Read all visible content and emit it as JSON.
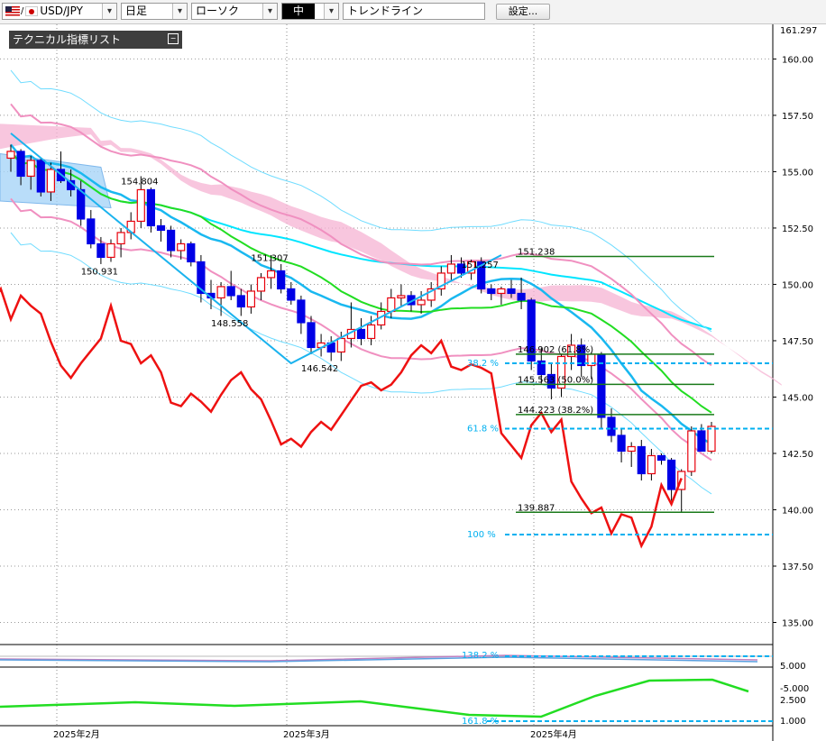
{
  "toolbar": {
    "symbol": "USD/JPY",
    "timeframe": "日足",
    "chart_type": "ローソク",
    "line_width": "中",
    "tool": "トレンドライン",
    "settings_label": "設定..."
  },
  "legend": {
    "label": "テクニカル指標リスト"
  },
  "axis": {
    "top_label": "161.297",
    "price_ticks": [
      {
        "v": 160.0,
        "t": "160.00"
      },
      {
        "v": 157.5,
        "t": "157.50"
      },
      {
        "v": 155.0,
        "t": "155.00"
      },
      {
        "v": 152.5,
        "t": "152.50"
      },
      {
        "v": 150.0,
        "t": "150.00"
      },
      {
        "v": 147.5,
        "t": "147.50"
      },
      {
        "v": 145.0,
        "t": "145.00"
      },
      {
        "v": 142.5,
        "t": "142.50"
      },
      {
        "v": 140.0,
        "t": "140.00"
      },
      {
        "v": 137.5,
        "t": "137.50"
      },
      {
        "v": 135.0,
        "t": "135.00"
      }
    ],
    "sub1_ticks": [
      {
        "t": "5.000"
      },
      {
        "t": "-5.000"
      }
    ],
    "sub2_ticks": [
      {
        "t": "2.500"
      },
      {
        "t": "1.000"
      }
    ],
    "dates": [
      "2025年2月",
      "2025年3月",
      "2025年4月"
    ]
  },
  "annotations": {
    "price_labels": [
      "154.804",
      "150.931",
      "151.307",
      "148.558",
      "146.542",
      "151.257"
    ],
    "fib_levels": [
      {
        "v": 151.238,
        "t": "151.238"
      },
      {
        "v": 146.902,
        "t": "146.902 (61.8%)"
      },
      {
        "v": 145.563,
        "t": "145.563 (50.0%)"
      },
      {
        "v": 144.223,
        "t": "144.223 (38.2%)"
      },
      {
        "v": 139.887,
        "t": "139.887"
      }
    ],
    "ext_levels": [
      {
        "v": 146.5,
        "t": "38.2 %"
      },
      {
        "v": 143.6,
        "t": "61.8 %"
      },
      {
        "v": 138.9,
        "t": "100 %"
      }
    ],
    "sub_labels": [
      "138.2 %",
      "161.8 %"
    ]
  },
  "chart_data": {
    "type": "candlestick",
    "ylim": [
      134.5,
      161.297
    ],
    "colors": {
      "up": "#e8000b",
      "down": "#0000e6",
      "cloud": "#f6b3d3",
      "ma_long": "#00e5ff",
      "ma_mid": "#19b8f0",
      "green": "#22dd22",
      "pink": "#f090c0",
      "red_line": "#ee1111",
      "fib": "#1a7a1a",
      "ext": "#00b0f0"
    },
    "candles": [
      {
        "o": 155.6,
        "h": 156.2,
        "l": 155.0,
        "c": 155.9
      },
      {
        "o": 155.9,
        "h": 156.0,
        "l": 154.4,
        "c": 154.8
      },
      {
        "o": 154.8,
        "h": 155.7,
        "l": 154.2,
        "c": 155.5
      },
      {
        "o": 155.5,
        "h": 155.6,
        "l": 153.9,
        "c": 154.1
      },
      {
        "o": 154.1,
        "h": 155.4,
        "l": 153.7,
        "c": 155.1
      },
      {
        "o": 155.1,
        "h": 155.9,
        "l": 154.5,
        "c": 154.6
      },
      {
        "o": 154.6,
        "h": 155.1,
        "l": 153.9,
        "c": 154.2
      },
      {
        "o": 154.2,
        "h": 154.6,
        "l": 152.6,
        "c": 152.9
      },
      {
        "o": 152.9,
        "h": 153.3,
        "l": 151.6,
        "c": 151.8
      },
      {
        "o": 151.8,
        "h": 152.1,
        "l": 150.9,
        "c": 151.2
      },
      {
        "o": 151.2,
        "h": 152.0,
        "l": 151.0,
        "c": 151.8
      },
      {
        "o": 151.8,
        "h": 152.5,
        "l": 151.2,
        "c": 152.3
      },
      {
        "o": 152.3,
        "h": 153.2,
        "l": 152.0,
        "c": 152.8
      },
      {
        "o": 152.8,
        "h": 154.8,
        "l": 152.5,
        "c": 154.2
      },
      {
        "o": 154.2,
        "h": 154.3,
        "l": 152.3,
        "c": 152.6
      },
      {
        "o": 152.6,
        "h": 152.9,
        "l": 151.9,
        "c": 152.4
      },
      {
        "o": 152.4,
        "h": 152.6,
        "l": 151.2,
        "c": 151.5
      },
      {
        "o": 151.5,
        "h": 152.0,
        "l": 151.1,
        "c": 151.8
      },
      {
        "o": 151.8,
        "h": 151.9,
        "l": 150.8,
        "c": 151.0
      },
      {
        "o": 151.0,
        "h": 151.3,
        "l": 149.2,
        "c": 149.6
      },
      {
        "o": 149.6,
        "h": 150.2,
        "l": 148.9,
        "c": 149.4
      },
      {
        "o": 149.4,
        "h": 150.1,
        "l": 148.6,
        "c": 149.9
      },
      {
        "o": 149.9,
        "h": 150.6,
        "l": 149.3,
        "c": 149.5
      },
      {
        "o": 149.5,
        "h": 149.8,
        "l": 148.6,
        "c": 149.0
      },
      {
        "o": 149.0,
        "h": 150.0,
        "l": 148.7,
        "c": 149.7
      },
      {
        "o": 149.7,
        "h": 150.5,
        "l": 149.3,
        "c": 150.3
      },
      {
        "o": 150.3,
        "h": 151.3,
        "l": 149.8,
        "c": 150.6
      },
      {
        "o": 150.6,
        "h": 150.9,
        "l": 149.6,
        "c": 149.8
      },
      {
        "o": 149.8,
        "h": 150.1,
        "l": 149.1,
        "c": 149.3
      },
      {
        "o": 149.3,
        "h": 149.5,
        "l": 147.8,
        "c": 148.3
      },
      {
        "o": 148.3,
        "h": 148.6,
        "l": 146.9,
        "c": 147.2
      },
      {
        "o": 147.2,
        "h": 147.8,
        "l": 146.8,
        "c": 147.4
      },
      {
        "o": 147.4,
        "h": 147.7,
        "l": 146.6,
        "c": 147.0
      },
      {
        "o": 147.0,
        "h": 147.9,
        "l": 146.6,
        "c": 147.6
      },
      {
        "o": 147.6,
        "h": 149.2,
        "l": 147.2,
        "c": 148.0
      },
      {
        "o": 148.0,
        "h": 148.5,
        "l": 147.3,
        "c": 147.6
      },
      {
        "o": 147.6,
        "h": 148.6,
        "l": 147.3,
        "c": 148.2
      },
      {
        "o": 148.2,
        "h": 149.2,
        "l": 148.0,
        "c": 148.8
      },
      {
        "o": 148.8,
        "h": 149.8,
        "l": 148.5,
        "c": 149.4
      },
      {
        "o": 149.4,
        "h": 150.0,
        "l": 149.0,
        "c": 149.5
      },
      {
        "o": 149.5,
        "h": 149.7,
        "l": 148.8,
        "c": 149.1
      },
      {
        "o": 149.1,
        "h": 149.7,
        "l": 148.7,
        "c": 149.3
      },
      {
        "o": 149.3,
        "h": 150.1,
        "l": 149.0,
        "c": 149.8
      },
      {
        "o": 149.8,
        "h": 150.8,
        "l": 149.5,
        "c": 150.5
      },
      {
        "o": 150.5,
        "h": 151.3,
        "l": 150.2,
        "c": 150.9
      },
      {
        "o": 150.9,
        "h": 151.2,
        "l": 150.3,
        "c": 150.5
      },
      {
        "o": 150.5,
        "h": 151.1,
        "l": 150.2,
        "c": 151.0
      },
      {
        "o": 151.0,
        "h": 151.2,
        "l": 149.6,
        "c": 149.8
      },
      {
        "o": 149.8,
        "h": 150.0,
        "l": 149.3,
        "c": 149.6
      },
      {
        "o": 149.6,
        "h": 149.9,
        "l": 149.1,
        "c": 149.8
      },
      {
        "o": 149.8,
        "h": 150.2,
        "l": 149.4,
        "c": 149.6
      },
      {
        "o": 149.6,
        "h": 150.3,
        "l": 148.9,
        "c": 149.3
      },
      {
        "o": 149.3,
        "h": 149.4,
        "l": 146.2,
        "c": 146.6
      },
      {
        "o": 146.6,
        "h": 147.2,
        "l": 145.6,
        "c": 146.0
      },
      {
        "o": 146.0,
        "h": 146.5,
        "l": 144.9,
        "c": 145.4
      },
      {
        "o": 145.4,
        "h": 146.9,
        "l": 145.0,
        "c": 146.8
      },
      {
        "o": 146.8,
        "h": 147.8,
        "l": 146.2,
        "c": 147.3
      },
      {
        "o": 147.3,
        "h": 147.6,
        "l": 145.9,
        "c": 146.4
      },
      {
        "o": 146.4,
        "h": 147.0,
        "l": 145.8,
        "c": 146.9
      },
      {
        "o": 146.9,
        "h": 147.0,
        "l": 143.6,
        "c": 144.1
      },
      {
        "o": 144.1,
        "h": 144.5,
        "l": 143.0,
        "c": 143.3
      },
      {
        "o": 143.3,
        "h": 143.6,
        "l": 142.1,
        "c": 142.6
      },
      {
        "o": 142.6,
        "h": 143.0,
        "l": 141.9,
        "c": 142.8
      },
      {
        "o": 142.8,
        "h": 143.1,
        "l": 141.3,
        "c": 141.6
      },
      {
        "o": 141.6,
        "h": 142.7,
        "l": 141.3,
        "c": 142.4
      },
      {
        "o": 142.4,
        "h": 142.5,
        "l": 142.0,
        "c": 142.2
      },
      {
        "o": 142.2,
        "h": 142.3,
        "l": 140.4,
        "c": 140.9
      },
      {
        "o": 140.9,
        "h": 141.8,
        "l": 139.9,
        "c": 141.7
      },
      {
        "o": 141.7,
        "h": 143.7,
        "l": 141.5,
        "c": 143.5
      },
      {
        "o": 143.5,
        "h": 143.8,
        "l": 142.6,
        "c": 142.6
      },
      {
        "o": 142.6,
        "h": 143.9,
        "l": 142.5,
        "c": 143.7
      }
    ]
  }
}
